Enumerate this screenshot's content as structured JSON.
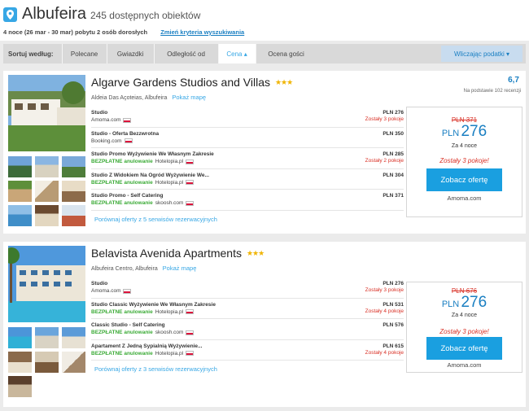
{
  "header": {
    "city": "Albufeira",
    "count": "245 dostępnych obiektów",
    "stay": "4 noce (26 mar - 30 mar) pobytu 2 osób dorosłych",
    "change_link": "Zmień kryteria wyszukiwania"
  },
  "sortbar": {
    "label": "Sortuj według:",
    "items": [
      "Polecane",
      "Gwiazdki",
      "Odległość od",
      "Cena ▴",
      "Ocena gości"
    ],
    "active_index": 3,
    "tax": "Wliczając podatki ▾"
  },
  "colors": {
    "accent": "#37a7e5",
    "cta": "#1a9fe0",
    "alert": "#d93025",
    "free": "#3aaa35",
    "stars": "#f0b400"
  },
  "hotels": [
    {
      "name": "Algarve Gardens Studios and Villas",
      "stars": "★★★",
      "address": "Aldeia Das Açoteias, Albufeira",
      "map_link": "Pokaż mapę",
      "rating": "6,7",
      "reviews": "Na podstawie 102 recenzji",
      "offers": [
        {
          "name": "Studio",
          "site": "Amoma.com",
          "free": "",
          "price": "PLN 276",
          "rooms": "Zostały 3 pokoje"
        },
        {
          "name": "Studio - Oferta Bezzwrotna",
          "site": "Booking.com",
          "free": "",
          "price": "PLN 350",
          "rooms": ""
        },
        {
          "name": "Studio Promo Wyżywienie We Własnym Zakresie",
          "site": "Hotelopia.pl",
          "free": "BEZPŁATNE anulowanie",
          "price": "PLN 285",
          "rooms": "Zostały 2 pokoje"
        },
        {
          "name": "Studio Z Widokiem Na Ogród Wyżywienie We...",
          "site": "Hotelopia.pl",
          "free": "BEZPŁATNE anulowanie",
          "price": "PLN 304",
          "rooms": ""
        },
        {
          "name": "Studio Promo - Self Catering",
          "site": "skoosh.com",
          "free": "BEZPŁATNE anulowanie",
          "price": "PLN 371",
          "rooms": ""
        }
      ],
      "compare": "Porównaj oferty z 5 serwisów rezerwacyjnych",
      "box": {
        "old": "PLN 371",
        "currency": "PLN",
        "amount": "276",
        "nights": "Za 4 noce",
        "left": "Zostały 3 pokoje!",
        "cta": "Zobacz ofertę",
        "source": "Amoma.com"
      }
    },
    {
      "name": "Belavista Avenida Apartments",
      "stars": "★★★",
      "address": "Albufeira Centro, Albufeira",
      "map_link": "Pokaż mapę",
      "offers": [
        {
          "name": "Studio",
          "site": "Amoma.com",
          "free": "",
          "price": "PLN 276",
          "rooms": "Zostały 3 pokoje"
        },
        {
          "name": "Studio Classic Wyżywienie We Własnym Zakresie",
          "site": "Hotelopia.pl",
          "free": "BEZPŁATNE anulowanie",
          "price": "PLN 531",
          "rooms": "Zostały 4 pokoje"
        },
        {
          "name": "Classic Studio - Self Catering",
          "site": "skoosh.com",
          "free": "BEZPŁATNE anulowanie",
          "price": "PLN 576",
          "rooms": ""
        },
        {
          "name": "Apartament Z Jedną Sypialnią Wyżywienie...",
          "site": "Hotelopia.pl",
          "free": "BEZPŁATNE anulowanie",
          "price": "PLN 615",
          "rooms": "Zostały 4 pokoje"
        }
      ],
      "compare": "Porównaj oferty z 3 serwisów rezerwacyjnych",
      "box": {
        "old": "PLN 676",
        "currency": "PLN",
        "amount": "276",
        "nights": "Za 4 noce",
        "left": "Zostały 3 pokoje!",
        "cta": "Zobacz ofertę",
        "source": "Amoma.com"
      }
    }
  ]
}
